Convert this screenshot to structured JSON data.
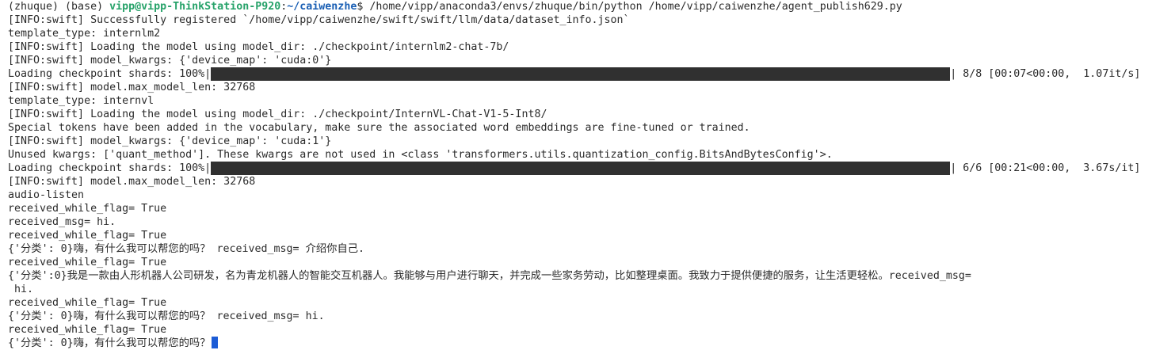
{
  "terminal": {
    "prompt": {
      "env_prefix": "(zhuque) (base) ",
      "user_host": "vipp@vipp-ThinkStation-P920",
      "separator": ":",
      "path": "~/caiwenzhe",
      "suffix": "$ ",
      "command": "/home/vipp/anaconda3/envs/zhuque/bin/python /home/vipp/caiwenzhe/agent_publish629.py"
    },
    "lines": [
      "[INFO:swift] Successfully registered `/home/vipp/caiwenzhe/swift/swift/llm/data/dataset_info.json`",
      "template_type: internlm2",
      "[INFO:swift] Loading the model using model_dir: ./checkpoint/internlm2-chat-7b/",
      "[INFO:swift] model_kwargs: {'device_map': 'cuda:0'}"
    ],
    "progress_1": {
      "prefix": "Loading checkpoint shards: 100%|",
      "suffix": "| 8/8 [00:07<00:00,  1.07it/s]",
      "progress": 1.0
    },
    "lines_2": [
      "[INFO:swift] model.max_model_len: 32768",
      "template_type: internvl",
      "[INFO:swift] Loading the model using model_dir: ./checkpoint/InternVL-Chat-V1-5-Int8/",
      "Special tokens have been added in the vocabulary, make sure the associated word embeddings are fine-tuned or trained.",
      "[INFO:swift] model_kwargs: {'device_map': 'cuda:1'}",
      "Unused kwargs: ['quant_method']. These kwargs are not used in <class 'transformers.utils.quantization_config.BitsAndBytesConfig'>."
    ],
    "progress_2": {
      "prefix": "Loading checkpoint shards: 100%|",
      "suffix": "| 6/6 [00:21<00:00,  3.67s/it]",
      "progress": 1.0
    },
    "lines_3": [
      "[INFO:swift] model.max_model_len: 32768",
      "audio-listen",
      "received_while_flag= True",
      "received_msg= hi.",
      "received_while_flag= True",
      "{'分类': 0}嗨，有什么我可以帮您的吗？ received_msg= 介绍你自己.",
      "received_while_flag= True",
      "{'分类':0}我是一款由人形机器人公司研发，名为青龙机器人的智能交互机器人。我能够与用户进行聊天，并完成一些家务劳动，比如整理桌面。我致力于提供便捷的服务，让生活更轻松。received_msg=",
      " hi.",
      "received_while_flag= True",
      "{'分类': 0}嗨，有什么我可以帮您的吗？ received_msg= hi.",
      "received_while_flag= True"
    ],
    "last_line": "{'分类': 0}嗨，有什么我可以帮您的吗？"
  }
}
